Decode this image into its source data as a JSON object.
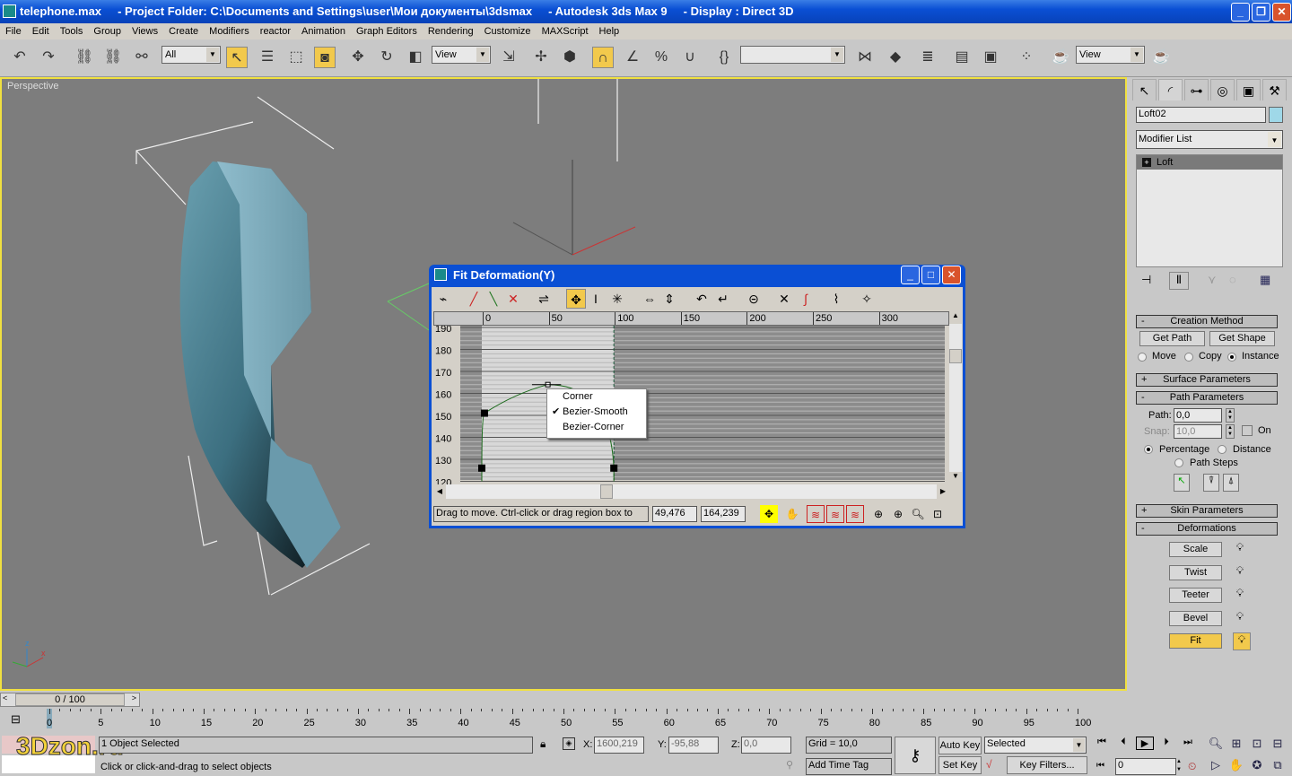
{
  "window": {
    "title": "telephone.max     - Project Folder: C:\\Documents and Settings\\user\\Мои документы\\3dsmax     - Autodesk 3ds Max 9     - Display : Direct 3D",
    "minimize": "_",
    "maximize": "❐",
    "close": "✕"
  },
  "menu": [
    "File",
    "Edit",
    "Tools",
    "Group",
    "Views",
    "Create",
    "Modifiers",
    "reactor",
    "Animation",
    "Graph Editors",
    "Rendering",
    "Customize",
    "MAXScript",
    "Help"
  ],
  "toolbar": {
    "selection_filter": "All",
    "ref_coord": "View",
    "named_selection": "",
    "view_combo": "View",
    "icons": [
      "undo-icon",
      "redo-icon",
      "select-and-link-icon",
      "unlink-icon",
      "bind-space-warp-icon",
      "select-object-icon",
      "select-by-name-icon",
      "rectangle-region-icon",
      "window-crossing-icon",
      "move-icon",
      "rotate-icon",
      "scale-icon",
      "pivot-center-icon",
      "manipulate-icon",
      "keyboard-shortcut-icon",
      "snap-3d-icon",
      "angle-snap-icon",
      "percent-snap-icon",
      "spinner-snap-icon",
      "edit-named-selection-icon",
      "mirror-icon",
      "align-icon",
      "layer-manager-icon",
      "curve-editor-icon",
      "schematic-view-icon",
      "material-editor-icon",
      "render-setup-icon",
      "quick-render-icon"
    ]
  },
  "viewport": {
    "label": "Perspective",
    "axis_x": "x",
    "axis_y": "y",
    "axis_z": "z"
  },
  "dialog": {
    "title": "Fit Deformation(Y)",
    "ruler": [
      "0",
      "50",
      "100",
      "150",
      "200",
      "250",
      "300"
    ],
    "y_labels": [
      "190",
      "180",
      "170",
      "160",
      "150",
      "140",
      "130",
      "120"
    ],
    "context_menu": [
      {
        "label": "Corner",
        "checked": false
      },
      {
        "label": "Bezier-Smooth",
        "checked": true
      },
      {
        "label": "Bezier-Corner",
        "checked": false
      }
    ],
    "status_text": "Drag to move. Ctrl-click or drag region box to add t",
    "x_value": "49,476",
    "y_value": "164,239",
    "curve_points": [
      [
        0,
        126
      ],
      [
        2,
        151
      ],
      [
        50,
        164
      ],
      [
        100,
        126
      ]
    ]
  },
  "panel": {
    "object_name": "Loft02",
    "object_color": "#9fd8e8",
    "modifier_list": "Modifier List",
    "stack": [
      "Loft"
    ],
    "creation_method": {
      "title": "Creation Method",
      "get_path": "Get Path",
      "get_shape": "Get Shape",
      "move": "Move",
      "copy": "Copy",
      "instance": "Instance",
      "selected": "Instance"
    },
    "surface_parameters": "Surface Parameters",
    "path_parameters": {
      "title": "Path Parameters",
      "path_label": "Path:",
      "path_value": "0,0",
      "snap_label": "Snap:",
      "snap_value": "10,0",
      "on_label": "On",
      "percentage": "Percentage",
      "distance": "Distance",
      "path_steps": "Path Steps"
    },
    "skin_parameters": "Skin Parameters",
    "deformations": {
      "title": "Deformations",
      "items": [
        "Scale",
        "Twist",
        "Teeter",
        "Bevel",
        "Fit"
      ],
      "active": "Fit"
    }
  },
  "timeline": {
    "slider": "0 / 100",
    "ticks": [
      "0",
      "5",
      "10",
      "15",
      "20",
      "25",
      "30",
      "35",
      "40",
      "45",
      "50",
      "55",
      "60",
      "65",
      "70",
      "75",
      "80",
      "85",
      "90",
      "95",
      "100"
    ]
  },
  "status": {
    "selection": "1 Object Selected",
    "prompt": "Click or click-and-drag to select objects",
    "x_label": "X:",
    "x": "1600,219",
    "y_label": "Y:",
    "y": "-95,88",
    "z_label": "Z:",
    "z": "0,0",
    "grid": "Grid = 10,0",
    "add_time_tag": "Add Time Tag",
    "auto_key": "Auto Key",
    "set_key": "Set Key",
    "key_mode": "Selected",
    "key_filters": "Key Filters...",
    "frame": "0",
    "watermark": "3Dzon.ru"
  }
}
